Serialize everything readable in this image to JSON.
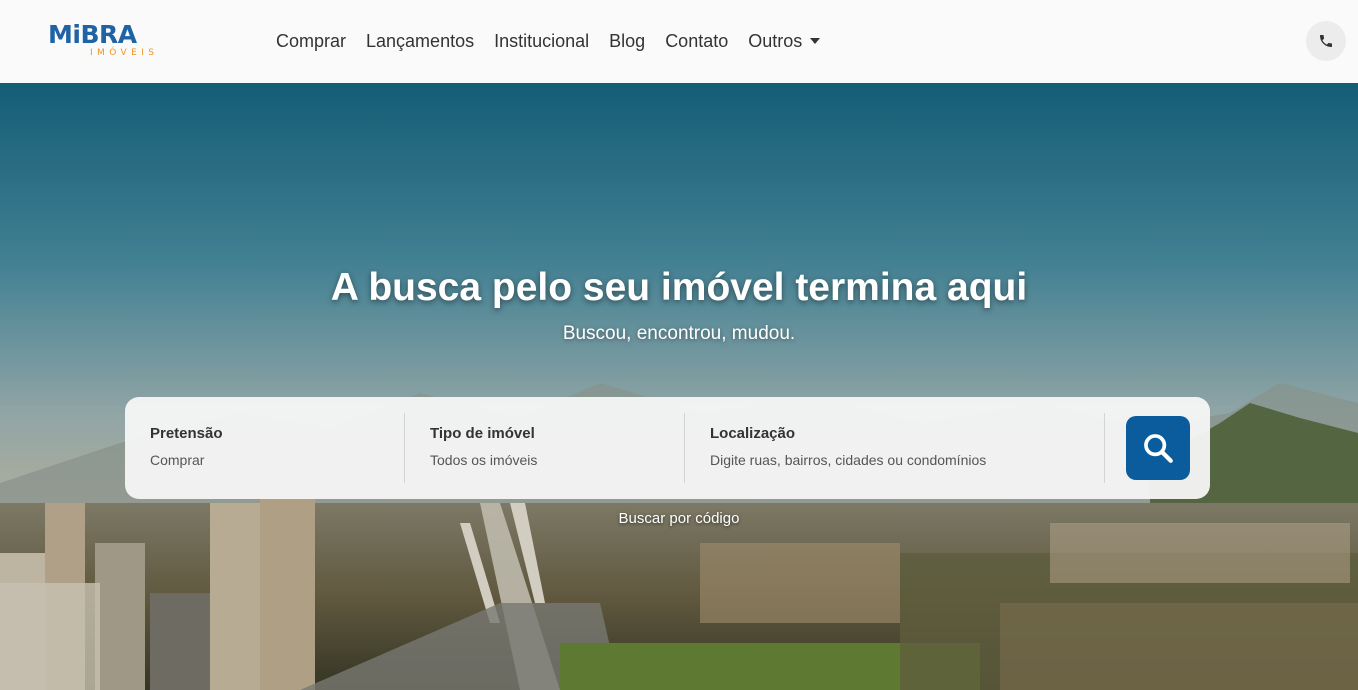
{
  "header": {
    "logo": {
      "main": "MiBRA",
      "sub": "IMÓVEIS"
    },
    "nav": [
      {
        "label": "Comprar"
      },
      {
        "label": "Lançamentos"
      },
      {
        "label": "Institucional"
      },
      {
        "label": "Blog"
      },
      {
        "label": "Contato"
      },
      {
        "label": "Outros"
      }
    ],
    "phone_icon": "phone-icon"
  },
  "hero": {
    "title": "A busca pelo seu imóvel termina aqui",
    "subtitle": "Buscou, encontrou, mudou."
  },
  "search": {
    "fields": [
      {
        "label": "Pretensão",
        "value": "Comprar"
      },
      {
        "label": "Tipo de imóvel",
        "value": "Todos os imóveis"
      },
      {
        "label": "Localização",
        "value": "Digite ruas, bairros, cidades ou condomínios"
      }
    ],
    "button_icon": "search-icon",
    "code_link": "Buscar por código"
  },
  "colors": {
    "brand_blue": "#1f62a6",
    "brand_orange": "#f0931f",
    "search_button": "#0a5c9c"
  }
}
